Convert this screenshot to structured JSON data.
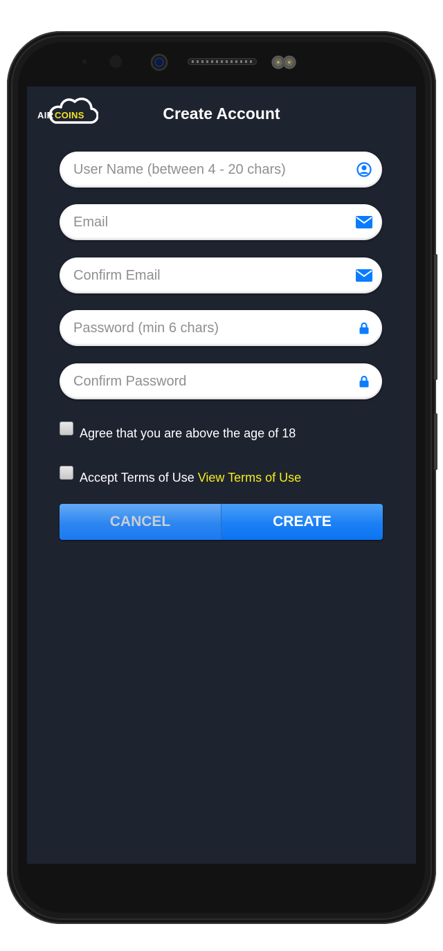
{
  "app": {
    "logo": {
      "part1": "AIR",
      "part2": "COINS"
    },
    "title": "Create Account"
  },
  "form": {
    "fields": [
      {
        "name": "username",
        "placeholder": "User Name (between 4 - 20 chars)",
        "value": "",
        "icon": "user-circle-icon"
      },
      {
        "name": "email",
        "placeholder": "Email",
        "value": "",
        "icon": "envelope-icon"
      },
      {
        "name": "confirm_email",
        "placeholder": "Confirm Email",
        "value": "",
        "icon": "envelope-icon"
      },
      {
        "name": "password",
        "placeholder": "Password (min 6 chars)",
        "value": "",
        "icon": "lock-icon"
      },
      {
        "name": "confirm_password",
        "placeholder": "Confirm Password",
        "value": "",
        "icon": "lock-icon"
      }
    ],
    "checkboxes": [
      {
        "label": "Agree that you are above the age of 18",
        "checked": false
      },
      {
        "label": "Accept Terms of Use",
        "link": "View Terms of Use",
        "checked": false
      }
    ],
    "buttons": {
      "cancel": "CANCEL",
      "create": "CREATE"
    }
  },
  "colors": {
    "background": "#1e2330",
    "accent_blue": "#1b7af0",
    "icon_blue": "#0a7cff",
    "link_yellow": "#f5ee1a",
    "logo_yellow": "#f3e423"
  }
}
